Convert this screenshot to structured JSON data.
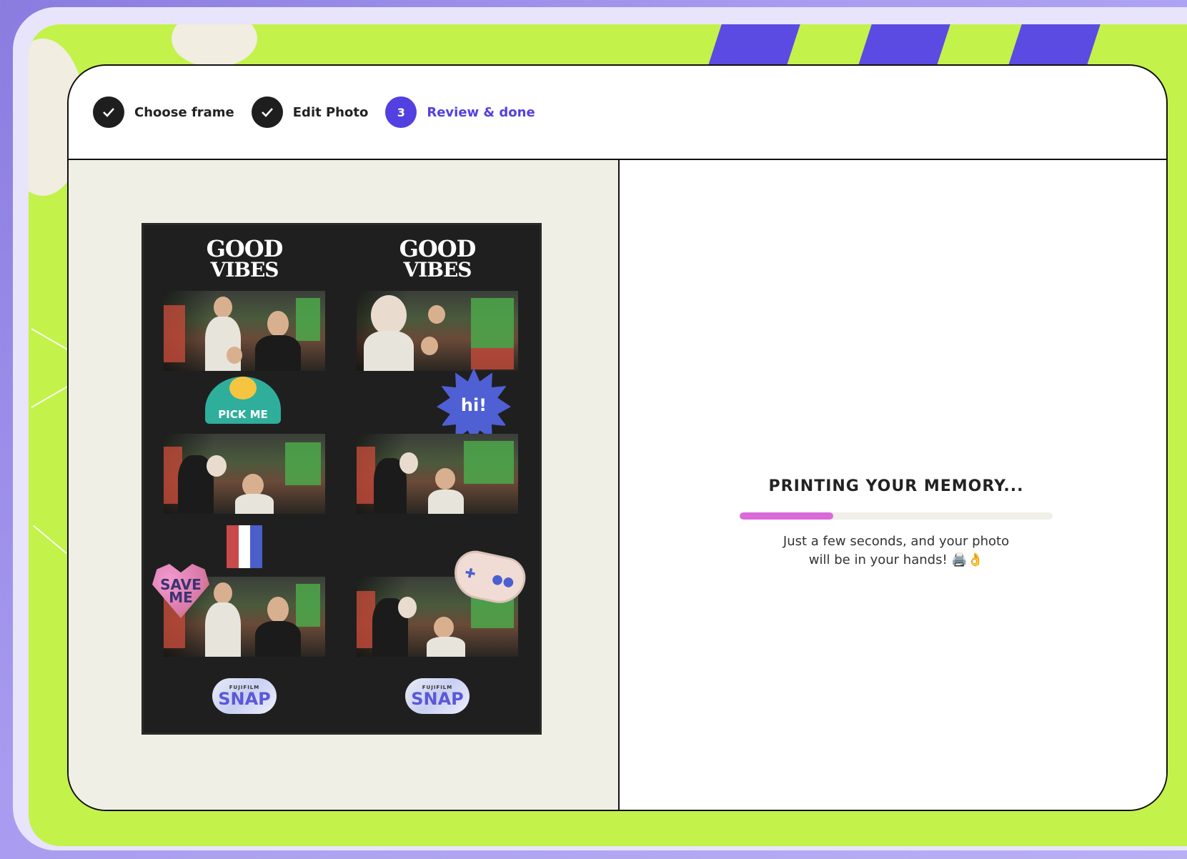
{
  "stepper": {
    "steps": [
      {
        "label": "Choose frame",
        "status": "done",
        "icon": "check-icon"
      },
      {
        "label": "Edit Photo",
        "status": "done",
        "icon": "check-icon"
      },
      {
        "label": "Review & done",
        "status": "active",
        "number": "3"
      }
    ]
  },
  "strip": {
    "header_line1": "GOOD",
    "header_line2": "VIBES",
    "stickers": {
      "pick_me": "PICK ME",
      "hi": "hi!",
      "save_me": "SAVE ME",
      "snap_brand": "FUJIFILM",
      "snap_word": "SNAP"
    }
  },
  "printing": {
    "title": "PRINTING YOUR MEMORY...",
    "progress": 0.3,
    "subtitle_line1": "Just a few seconds, and your photo",
    "subtitle_line2": "will be in your hands! 🖨️👌"
  },
  "colors": {
    "accent": "#5340e0",
    "lime": "#c3f24b",
    "progress": "#d96ad9",
    "strip_bg": "#1f1f20"
  }
}
